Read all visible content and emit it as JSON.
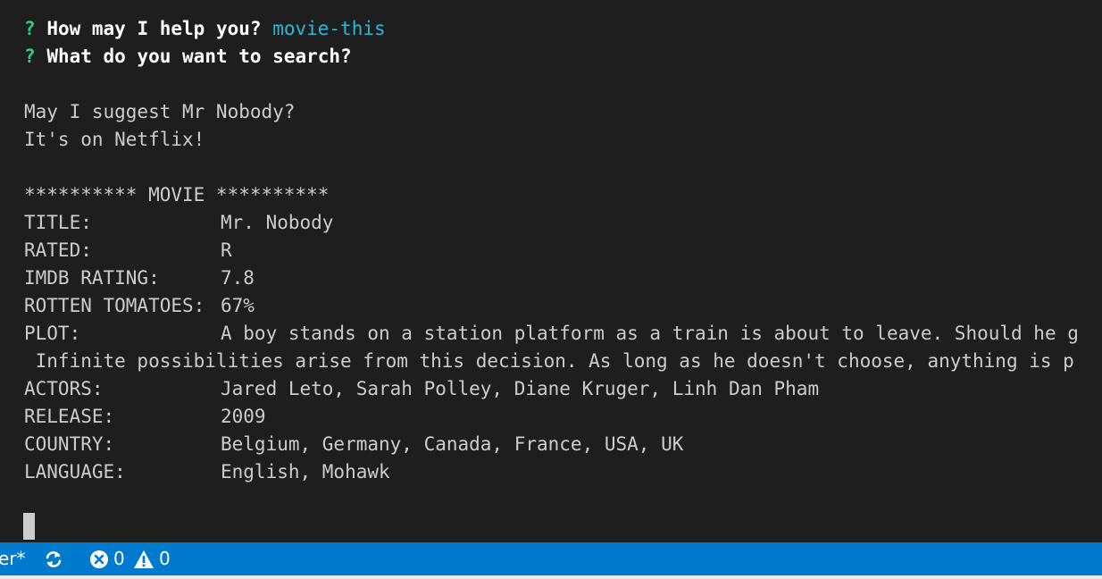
{
  "terminal": {
    "prompt1": {
      "marker": "?",
      "question": "How may I help you?",
      "answer": "movie-this"
    },
    "prompt2": {
      "marker": "?",
      "question": "What do you want to search?"
    },
    "suggestion": [
      "May I suggest Mr Nobody?",
      "It's on Netflix!"
    ],
    "header": "********** MOVIE **********",
    "fields": {
      "title": {
        "label": "TITLE:",
        "value": "Mr. Nobody"
      },
      "rated": {
        "label": "RATED:",
        "value": "R"
      },
      "imdb": {
        "label": "IMDB RATING:",
        "value": "7.8"
      },
      "rotten": {
        "label": "ROTTEN TOMATOES:",
        "value": "67%"
      },
      "plot": {
        "label": "PLOT:",
        "value": "A boy stands on a station platform as a train is about to leave. Should he g"
      },
      "actors": {
        "label": "ACTORS:",
        "value": "Jared Leto, Sarah Polley, Diane Kruger, Linh Dan Pham"
      },
      "release": {
        "label": "RELEASE:",
        "value": "2009"
      },
      "country": {
        "label": "COUNTRY:",
        "value": "Belgium, Germany, Canada, France, USA, UK"
      },
      "language": {
        "label": "LANGUAGE:",
        "value": "English, Mohawk"
      }
    },
    "plot_continuation": " Infinite possibilities arise from this decision. As long as he doesn't choose, anything is p"
  },
  "statusbar": {
    "branch_fragment": "er*",
    "errors": "0",
    "warnings": "0",
    "sync_icon": "sync-icon",
    "error_icon": "error-icon",
    "warning_icon": "warning-icon"
  },
  "colors": {
    "background": "#1e1e1e",
    "text": "#cccccc",
    "prompt_marker": "#23d18b",
    "answer": "#29b8db",
    "statusbar": "#007acc"
  }
}
